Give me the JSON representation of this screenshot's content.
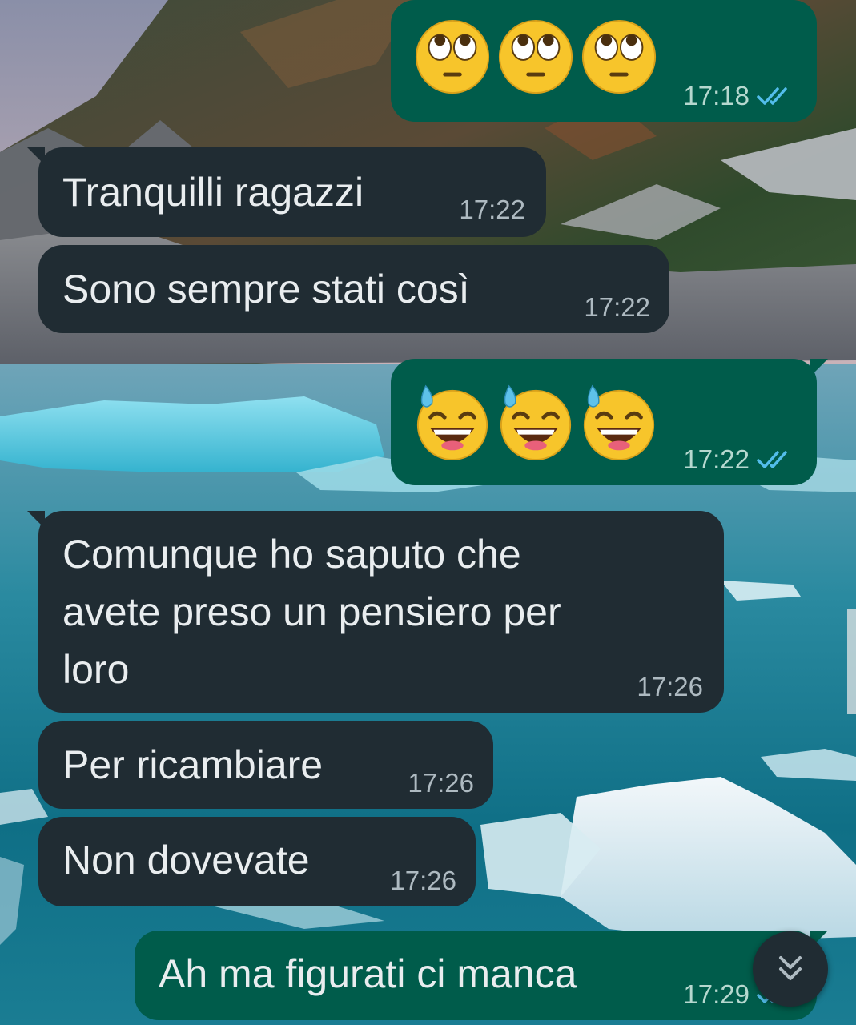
{
  "messages": [
    {
      "direction": "outgoing",
      "emoji": [
        "face-with-rolling-eyes",
        "face-with-rolling-eyes",
        "face-with-rolling-eyes"
      ],
      "time": "17:18",
      "status": "read"
    },
    {
      "direction": "incoming",
      "text": "Tranquilli ragazzi",
      "time": "17:22"
    },
    {
      "direction": "incoming",
      "text": "Sono sempre stati così",
      "time": "17:22"
    },
    {
      "direction": "outgoing",
      "emoji": [
        "grinning-face-with-sweat",
        "grinning-face-with-sweat",
        "grinning-face-with-sweat"
      ],
      "time": "17:22",
      "status": "read"
    },
    {
      "direction": "incoming",
      "lines": [
        "Comunque ho saputo che",
        "avete preso un pensiero per",
        "loro"
      ],
      "time": "17:26"
    },
    {
      "direction": "incoming",
      "text": "Per ricambiare",
      "time": "17:26"
    },
    {
      "direction": "incoming",
      "text": "Non dovevate",
      "time": "17:26"
    },
    {
      "direction": "outgoing",
      "text": "Ah ma figurati ci manca",
      "time": "17:29",
      "status": "read"
    }
  ],
  "scroll_button": {
    "icon": "double-chevron-down-icon"
  },
  "colors": {
    "incoming_bubble": "#202c33",
    "outgoing_bubble": "#005c4b",
    "message_text": "#e9edef",
    "timestamp": "#aebac1",
    "read_ticks": "#53bdeb"
  }
}
